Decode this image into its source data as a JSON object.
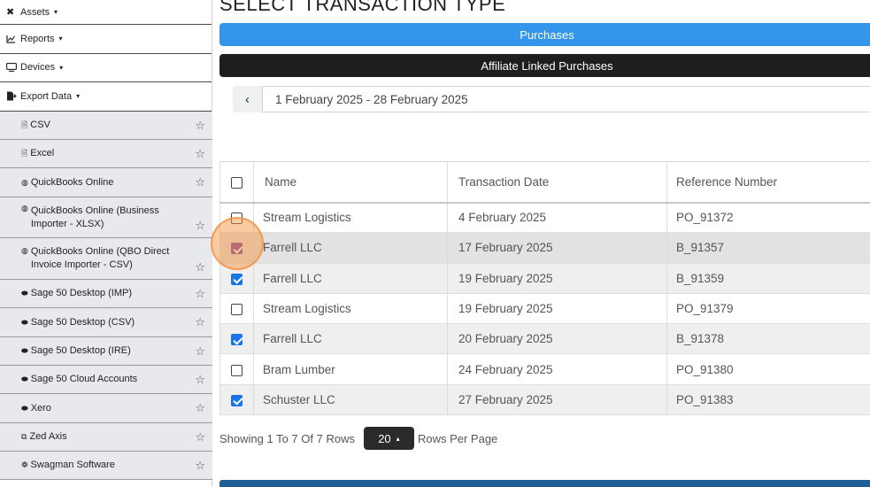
{
  "sidebar": {
    "items": [
      {
        "label": "Assets",
        "icon": "tools-icon",
        "glyph": "✖"
      },
      {
        "label": "Reports",
        "icon": "chart-line-icon",
        "glyph": "📈"
      },
      {
        "label": "Devices",
        "icon": "monitor-icon",
        "glyph": "🖵"
      },
      {
        "label": "Export Data",
        "icon": "file-export-icon",
        "glyph": "▙"
      }
    ],
    "caret": "▾",
    "subitems": [
      {
        "label": "CSV",
        "glyph": "🗎"
      },
      {
        "label": "Excel",
        "glyph": "🗎"
      },
      {
        "label": "QuickBooks Online",
        "glyph": "◍"
      },
      {
        "label": "QuickBooks Online (Business Importer - XLSX)",
        "glyph": "◍"
      },
      {
        "label": "QuickBooks Online (QBO Direct Invoice Importer - CSV)",
        "glyph": "◍"
      },
      {
        "label": "Sage 50 Desktop (IMP)",
        "glyph": "⬬"
      },
      {
        "label": "Sage 50 Desktop (CSV)",
        "glyph": "⬬"
      },
      {
        "label": "Sage 50 Desktop (IRE)",
        "glyph": "⬬"
      },
      {
        "label": "Sage 50 Cloud Accounts",
        "glyph": "⬬"
      },
      {
        "label": "Xero",
        "glyph": "⬬"
      },
      {
        "label": "Zed Axis",
        "glyph": "⧉"
      },
      {
        "label": "Swagman Software",
        "glyph": "❁"
      }
    ],
    "star": "☆"
  },
  "main": {
    "title": "SELECT TRANSACTION TYPE",
    "purchases_label": "Purchases",
    "affiliate_label": "Affiliate Linked Purchases",
    "prev_glyph": "‹",
    "date_range": "1 February 2025 - 28 February 2025"
  },
  "table": {
    "headers": {
      "name": "Name",
      "date": "Transaction Date",
      "ref": "Reference Number"
    },
    "rows": [
      {
        "name": "Stream Logistics",
        "date": "4 February 2025",
        "ref": "PO_91372",
        "checked": false
      },
      {
        "name": "Farrell LLC",
        "date": "17 February 2025",
        "ref": "B_91357",
        "checked": true
      },
      {
        "name": "Farrell LLC",
        "date": "19 February 2025",
        "ref": "B_91359",
        "checked": true
      },
      {
        "name": "Stream Logistics",
        "date": "19 February 2025",
        "ref": "PO_91379",
        "checked": false
      },
      {
        "name": "Farrell LLC",
        "date": "20 February 2025",
        "ref": "B_91378",
        "checked": true
      },
      {
        "name": "Bram Lumber",
        "date": "24 February 2025",
        "ref": "PO_91380",
        "checked": false
      },
      {
        "name": "Schuster LLC",
        "date": "27 February 2025",
        "ref": "PO_91383",
        "checked": true
      }
    ]
  },
  "pagination": {
    "showing": "Showing 1 To 7 Of 7 Rows",
    "rows_per_page_value": "20",
    "rows_per_page_label": "Rows Per Page",
    "up_glyph": "▴"
  },
  "colors": {
    "primary": "#3396ea",
    "dark": "#1e1e1e",
    "checkbox_checked": "#1a73e8",
    "click_highlight": "#f6a046"
  }
}
